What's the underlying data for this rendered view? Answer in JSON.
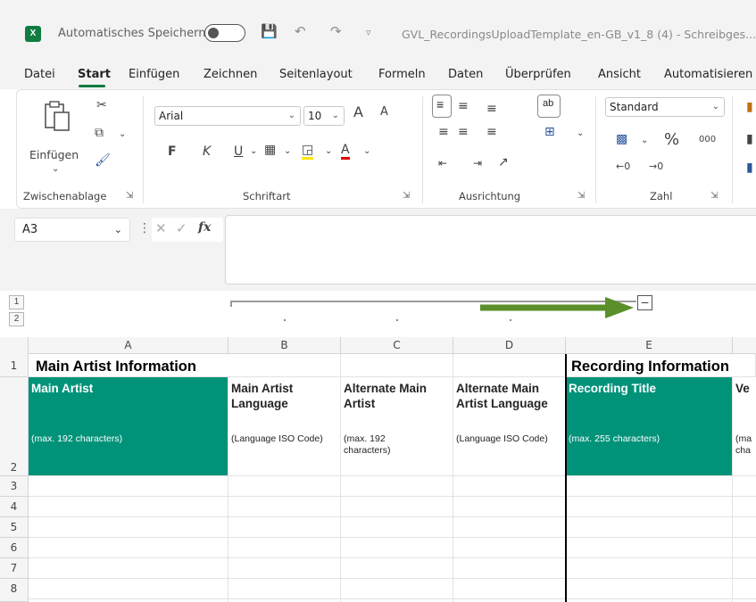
{
  "titlebar": {
    "autosave_label": "Automatisches Speichern",
    "filename": "GVL_RecordingsUploadTemplate_en-GB_v1_8 (4)  -  Schreibges...",
    "app_logo": "X"
  },
  "menu": [
    {
      "label": "Datei"
    },
    {
      "label": "Start"
    },
    {
      "label": "Einfügen"
    },
    {
      "label": "Zeichnen"
    },
    {
      "label": "Seitenlayout"
    },
    {
      "label": "Formeln"
    },
    {
      "label": "Daten"
    },
    {
      "label": "Überprüfen"
    },
    {
      "label": "Ansicht"
    },
    {
      "label": "Automatisieren"
    }
  ],
  "ribbon": {
    "clipboard": {
      "paste_label": "Einfügen",
      "group_label": "Zwischenablage"
    },
    "font": {
      "name": "Arial",
      "size": "10",
      "bold": "F",
      "italic": "K",
      "underline": "U",
      "grow": "A",
      "shrink": "A",
      "color_a": "A",
      "group_label": "Schriftart"
    },
    "alignment": {
      "group_label": "Ausrichtung"
    },
    "number": {
      "format": "Standard",
      "percent": "%",
      "thousands": "000",
      "group_label": "Zahl"
    }
  },
  "formula_bar": {
    "name_box": "A3",
    "fx": "fx",
    "value": ""
  },
  "outline": {
    "levels": [
      "1",
      "2"
    ],
    "collapse_symbol": "–"
  },
  "columns": [
    "A",
    "B",
    "C",
    "D",
    "E"
  ],
  "rows": [
    "1",
    "2",
    "3",
    "4",
    "5",
    "6",
    "7",
    "8"
  ],
  "sheet": {
    "section1": "Main Artist Information",
    "section2": "Recording Information",
    "headers": [
      {
        "title": "Main Artist",
        "sub": "(max. 192 characters)"
      },
      {
        "title": "Main Artist Language",
        "sub": "(Language ISO Code)"
      },
      {
        "title": "Alternate Main Artist",
        "sub": "(max. 192 characters)"
      },
      {
        "title": "Alternate Main Artist Language",
        "sub": "(Language ISO Code)"
      },
      {
        "title": "Recording Title",
        "sub": "(max. 255 characters)"
      },
      {
        "title": "Ve",
        "sub": "(ma cha"
      }
    ]
  },
  "colors": {
    "accent_green": "#107c41",
    "teal_header": "#00937a",
    "arrow_green": "#5a8f29"
  }
}
